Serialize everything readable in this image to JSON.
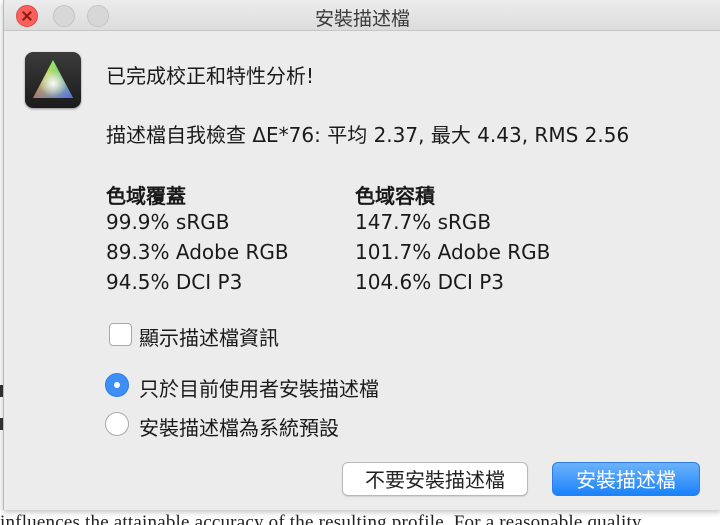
{
  "window": {
    "title": "安裝描述檔"
  },
  "dialog": {
    "headline": "已完成校正和特性分析!",
    "profile_check": "描述檔自我檢查 ΔE*76: 平均 2.37, 最大 4.43, RMS 2.56",
    "gamut_coverage": {
      "heading": "色域覆蓋",
      "items": [
        "99.9% sRGB",
        "89.3% Adobe RGB",
        "94.5% DCI P3"
      ]
    },
    "gamut_volume": {
      "heading": "色域容積",
      "items": [
        "147.7% sRGB",
        "101.7% Adobe RGB",
        "104.6% DCI P3"
      ]
    },
    "show_profile_info": {
      "label": "顯示描述檔資訊",
      "checked": false
    },
    "install_scope": {
      "options": [
        {
          "label": "只於目前使用者安裝描述檔",
          "selected": true
        },
        {
          "label": "安裝描述檔為系統預設",
          "selected": false
        }
      ]
    },
    "buttons": {
      "cancel": "不要安裝描述檔",
      "install": "安裝描述檔"
    }
  },
  "background": {
    "text": "influences the attainable accuracy of the resulting profile. For a reasonable quality"
  },
  "colors": {
    "accent": "#3d8ef5",
    "close": "#fc605c",
    "window_bg": "#ececec"
  }
}
